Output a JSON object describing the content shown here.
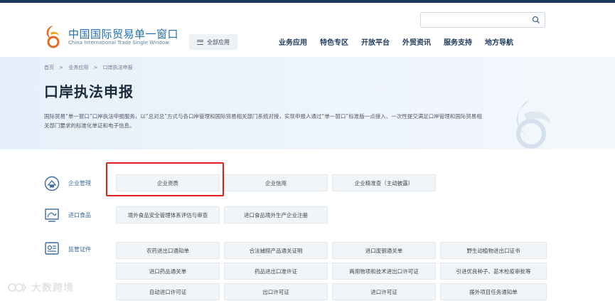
{
  "header": {
    "logo_cn": "中国国际贸易单一窗口",
    "logo_en": "China International Trade Single Window",
    "all_apps_label": "全部应用",
    "search_placeholder": "",
    "nav": [
      "业务应用",
      "特色专区",
      "开放平台",
      "外贸资讯",
      "服务支持",
      "地方导航"
    ]
  },
  "banner": {
    "breadcrumb": [
      "首页",
      ">",
      "业务应用",
      ">",
      "口岸执法申报"
    ],
    "title": "口岸执法申报",
    "description": "国际贸易“单一窗口”口岸执法申报服务，以“总对总”方式与各口岸管理和国际贸易相关部门系统对接，实现申报人通过“单一窗口”标准版一点接入、一次性提交满足口岸管理和国际贸易相关部门要求的标准化单证和电子信息。"
  },
  "categories": [
    {
      "label": "企业管理",
      "icon": "enterprise-icon",
      "buttons": [
        "企业资质",
        "企业信用",
        "企业精准查（主动披露）"
      ]
    },
    {
      "label": "进口食品",
      "icon": "food-import-icon",
      "buttons": [
        "境外食品安全管理体系评估与审查",
        "进口食品境外生产企业注册"
      ]
    },
    {
      "label": "监管证件",
      "icon": "certificate-icon",
      "buttons": [
        "农药进出口通知单",
        "合法捕捞产品通关证明",
        "进口废钢通关单",
        "野生动植物进出口证书",
        "进口药品通关单",
        "药品进出口准许证",
        "两用物项和技术进出口许可证",
        "引进优良种子、苗木检疫审批等",
        "自动进口许可证",
        "出口许可证",
        "进口许可证",
        "援外项目任务通知单"
      ]
    }
  ],
  "watermark": "大数跨境",
  "colors": {
    "brand": "#1f6fb3",
    "highlight": "#e02020",
    "banner_bg": "#e6f0fa",
    "button_bg": "#f2f5f8"
  }
}
